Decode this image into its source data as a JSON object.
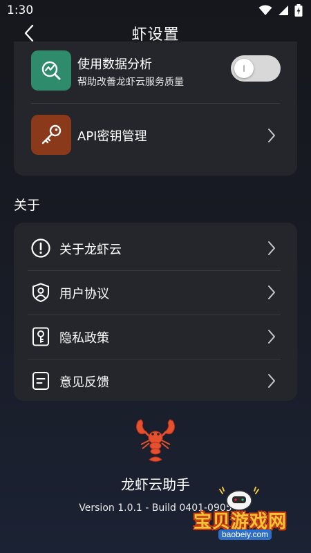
{
  "status_bar": {
    "time": "1:30"
  },
  "header": {
    "title": "虾设置"
  },
  "settings": {
    "analytics": {
      "title": "使用数据分析",
      "subtitle": "帮助改善龙虾云服务质量",
      "enabled": false
    },
    "api_keys": {
      "title": "API密钥管理"
    }
  },
  "about": {
    "section_label": "关于",
    "items": [
      {
        "label": "关于龙虾云",
        "icon": "info-icon"
      },
      {
        "label": "用户协议",
        "icon": "user-shield-icon"
      },
      {
        "label": "隐私政策",
        "icon": "key-document-icon"
      },
      {
        "label": "意见反馈",
        "icon": "feedback-note-icon"
      }
    ]
  },
  "footer": {
    "app_name": "龙虾云助手",
    "version": "Version 1.0.1 - Build 0401-0905"
  },
  "watermark": {
    "text": "宝贝游戏网",
    "url": "baobeiy.com"
  },
  "colors": {
    "analytics_icon_bg": "#2e8c6c",
    "api_icon_bg": "#8a3a1b",
    "card_bg": "#25262c",
    "toggle_off": "#d8d8d8"
  }
}
